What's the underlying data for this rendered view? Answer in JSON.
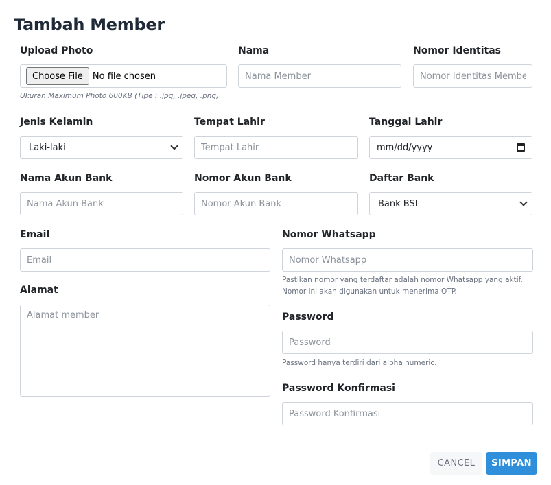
{
  "form": {
    "title": "Tambah Member",
    "upload_photo": {
      "label": "Upload Photo",
      "button_label": "Choose File",
      "status": "No file chosen",
      "hint": "Ukuran Maximum Photo 600KB (Tipe : .jpg, .jpeg, .png)"
    },
    "nama": {
      "label": "Nama",
      "placeholder": "Nama Member"
    },
    "nomor_identitas": {
      "label": "Nomor Identitas",
      "placeholder": "Nomor Identitas Member"
    },
    "jenis_kelamin": {
      "label": "Jenis Kelamin",
      "value": "Laki-laki"
    },
    "tempat_lahir": {
      "label": "Tempat Lahir",
      "placeholder": "Tempat Lahir"
    },
    "tanggal_lahir": {
      "label": "Tanggal Lahir",
      "placeholder": "mm/dd/yyyy"
    },
    "nama_akun_bank": {
      "label": "Nama Akun Bank",
      "placeholder": "Nama Akun Bank"
    },
    "nomor_akun_bank": {
      "label": "Nomor Akun Bank",
      "placeholder": "Nomor Akun Bank"
    },
    "daftar_bank": {
      "label": "Daftar Bank",
      "value": "Bank BSI"
    },
    "email": {
      "label": "Email",
      "placeholder": "Email"
    },
    "nomor_whatsapp": {
      "label": "Nomor Whatsapp",
      "placeholder": "Nomor Whatsapp",
      "hint_line1": "Pastikan nomor yang terdaftar adalah nomor Whatsapp yang aktif.",
      "hint_line2": "Nomor ini akan digunakan untuk menerima OTP."
    },
    "alamat": {
      "label": "Alamat",
      "placeholder": "Alamat member"
    },
    "password": {
      "label": "Password",
      "placeholder": "Password",
      "hint": "Password hanya terdiri dari alpha numeric."
    },
    "password_konfirmasi": {
      "label": "Password Konfirmasi",
      "placeholder": "Password Konfirmasi"
    },
    "actions": {
      "cancel_label": "CANCEL",
      "save_label": "SIMPAN"
    }
  }
}
